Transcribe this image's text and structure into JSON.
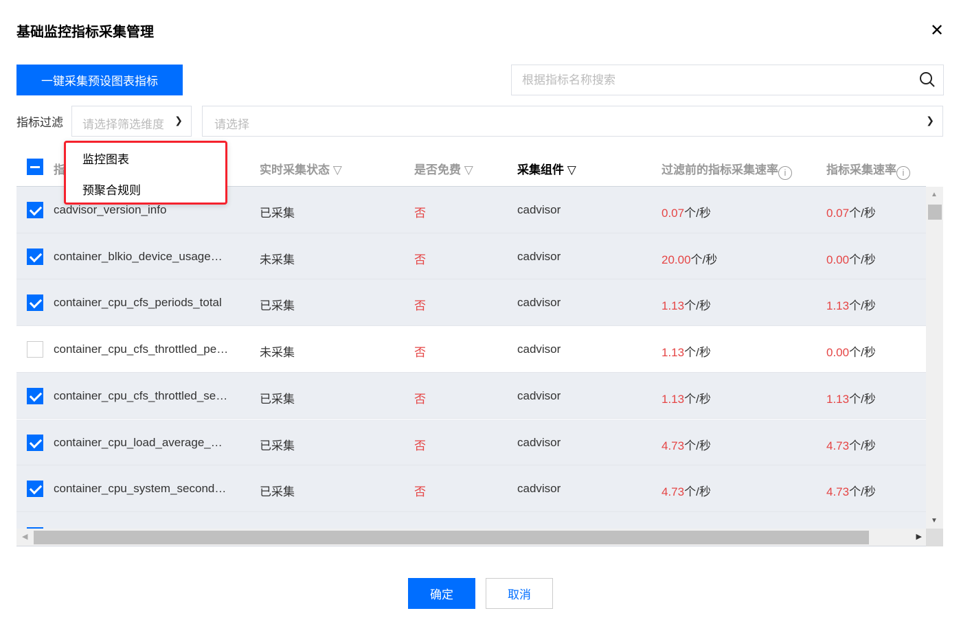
{
  "dialog": {
    "title": "基础监控指标采集管理",
    "close_icon": "close-icon"
  },
  "toolbar": {
    "collect_button": "一键采集预设图表指标",
    "search_placeholder": "根据指标名称搜索"
  },
  "filter": {
    "label": "指标过滤",
    "dimension_placeholder": "请选择筛选维度",
    "value_placeholder": "请选择"
  },
  "dropdown": {
    "items": [
      "监控图表",
      "预聚合规则"
    ]
  },
  "table": {
    "columns": [
      "指标名称",
      "实时采集状态",
      "是否免费",
      "采集组件",
      "过滤前的指标采集速率",
      "指标采集速率"
    ],
    "unit": "个/秒",
    "rows": [
      {
        "checked": true,
        "name": "cadvisor_version_info",
        "status": "已采集",
        "free": "否",
        "component": "cadvisor",
        "rate_before": "0.07",
        "rate": "0.07"
      },
      {
        "checked": true,
        "name": "container_blkio_device_usage…",
        "status": "未采集",
        "free": "否",
        "component": "cadvisor",
        "rate_before": "20.00",
        "rate": "0.00"
      },
      {
        "checked": true,
        "name": "container_cpu_cfs_periods_total",
        "status": "已采集",
        "free": "否",
        "component": "cadvisor",
        "rate_before": "1.13",
        "rate": "1.13"
      },
      {
        "checked": false,
        "name": "container_cpu_cfs_throttled_pe…",
        "status": "未采集",
        "free": "否",
        "component": "cadvisor",
        "rate_before": "1.13",
        "rate": "0.00"
      },
      {
        "checked": true,
        "name": "container_cpu_cfs_throttled_se…",
        "status": "已采集",
        "free": "否",
        "component": "cadvisor",
        "rate_before": "1.13",
        "rate": "1.13"
      },
      {
        "checked": true,
        "name": "container_cpu_load_average_…",
        "status": "已采集",
        "free": "否",
        "component": "cadvisor",
        "rate_before": "4.73",
        "rate": "4.73"
      },
      {
        "checked": true,
        "name": "container_cpu_system_second…",
        "status": "已采集",
        "free": "否",
        "component": "cadvisor",
        "rate_before": "4.73",
        "rate": "4.73"
      }
    ]
  },
  "footer": {
    "ok": "确定",
    "cancel": "取消"
  },
  "colors": {
    "primary": "#006eff",
    "danger": "#e54545",
    "highlight_border": "#f5222d"
  }
}
